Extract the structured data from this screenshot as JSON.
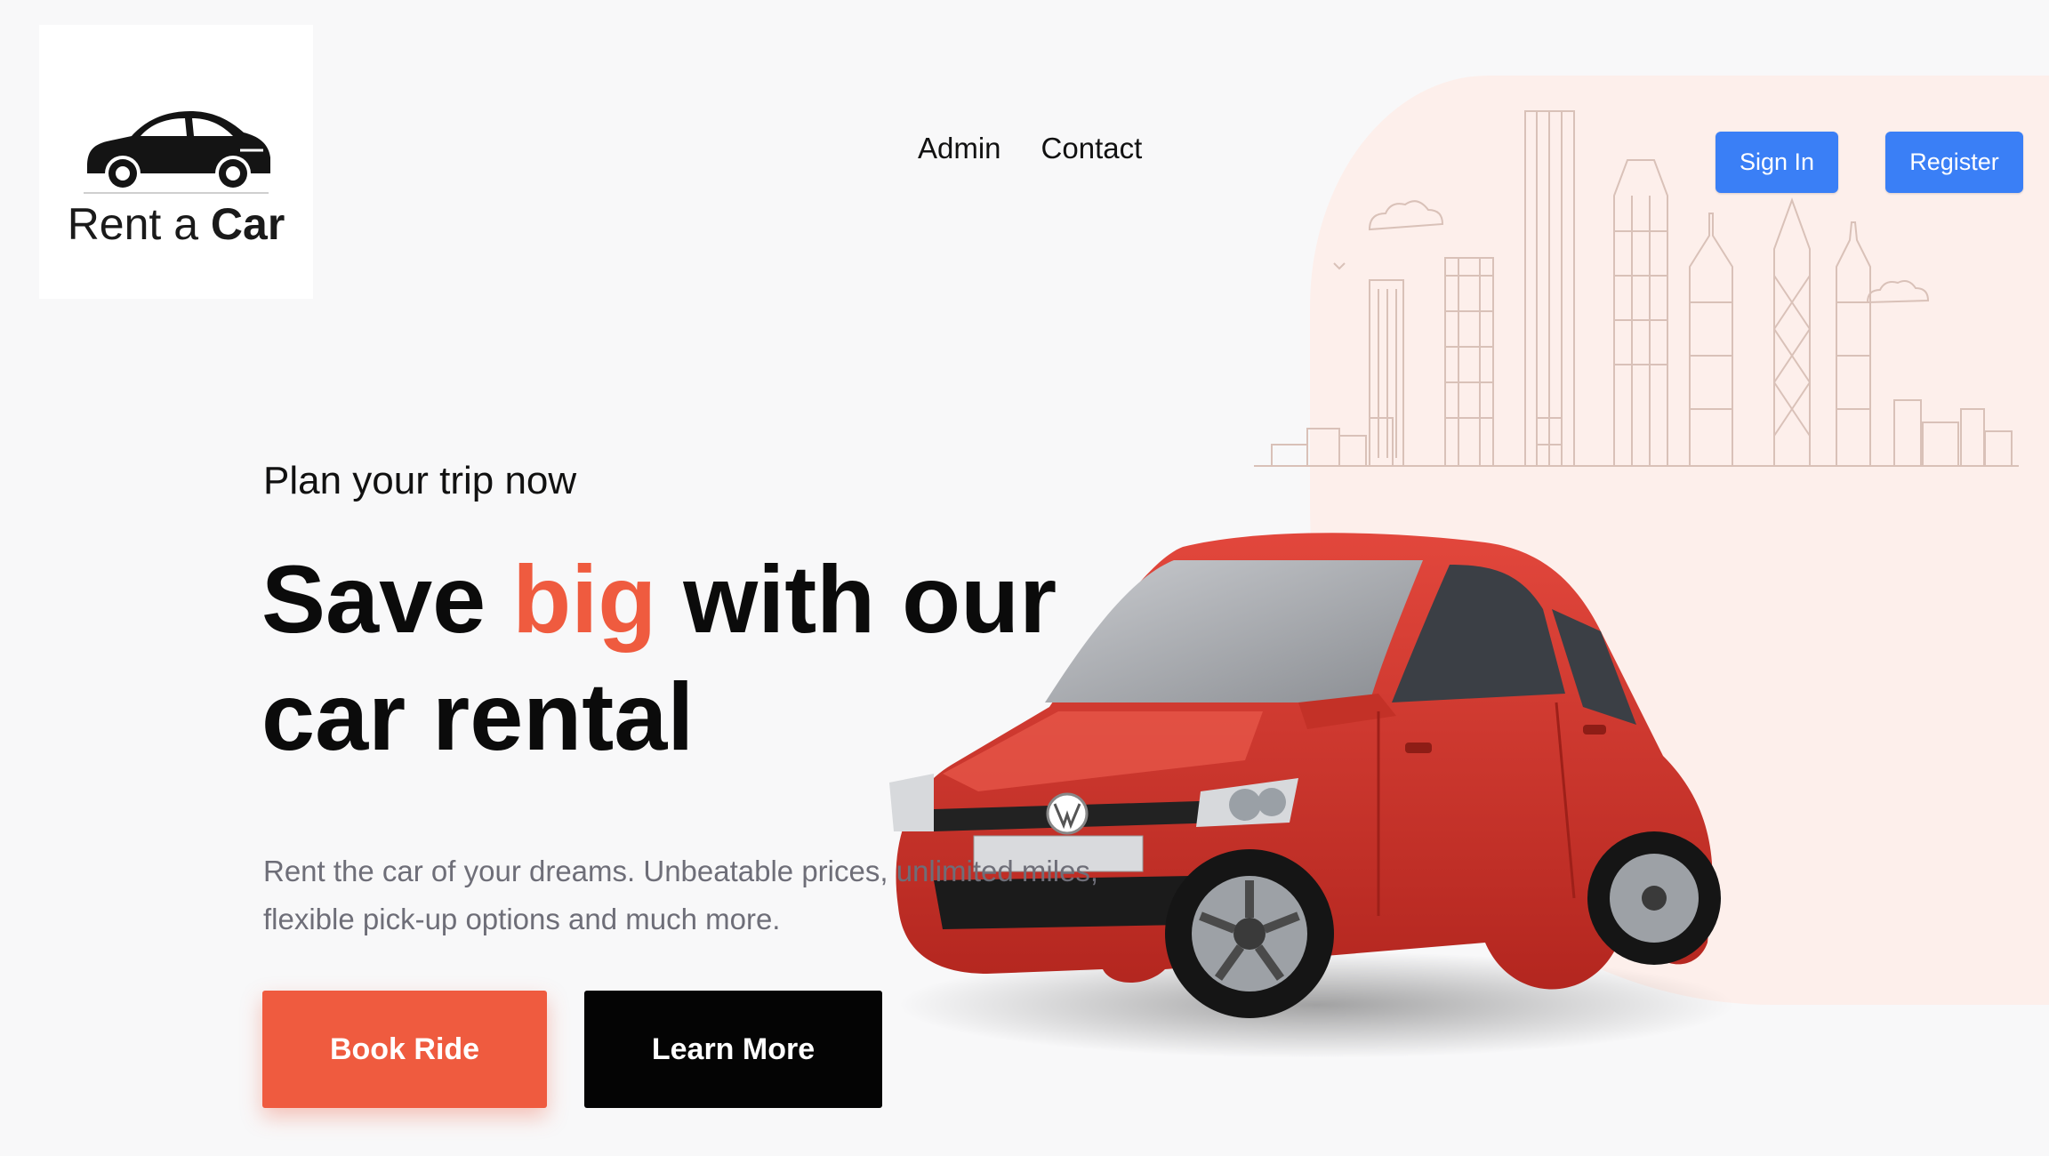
{
  "brand": {
    "logo_prefix": "Rent a ",
    "logo_bold": "Car"
  },
  "nav": {
    "links": [
      "Admin",
      "Contact"
    ]
  },
  "auth": {
    "sign_in": "Sign In",
    "register": "Register"
  },
  "hero": {
    "subtitle": "Plan your trip now",
    "title_part1": "Save ",
    "title_accent": "big",
    "title_part2": " with our car rental",
    "description": "Rent the car of your dreams. Unbeatable prices, unlimited miles, flexible pick-up options and much more.",
    "primary_cta": "Book Ride",
    "secondary_cta": "Learn More"
  },
  "colors": {
    "accent": "#ef5b3f",
    "auth_button": "#3a7ff6",
    "blob": "#fdefeb",
    "dark_button": "#040404"
  },
  "icons": {
    "logo": "car-silhouette-icon",
    "hero_image": "red-hatchback-car",
    "background": "city-skyline"
  }
}
